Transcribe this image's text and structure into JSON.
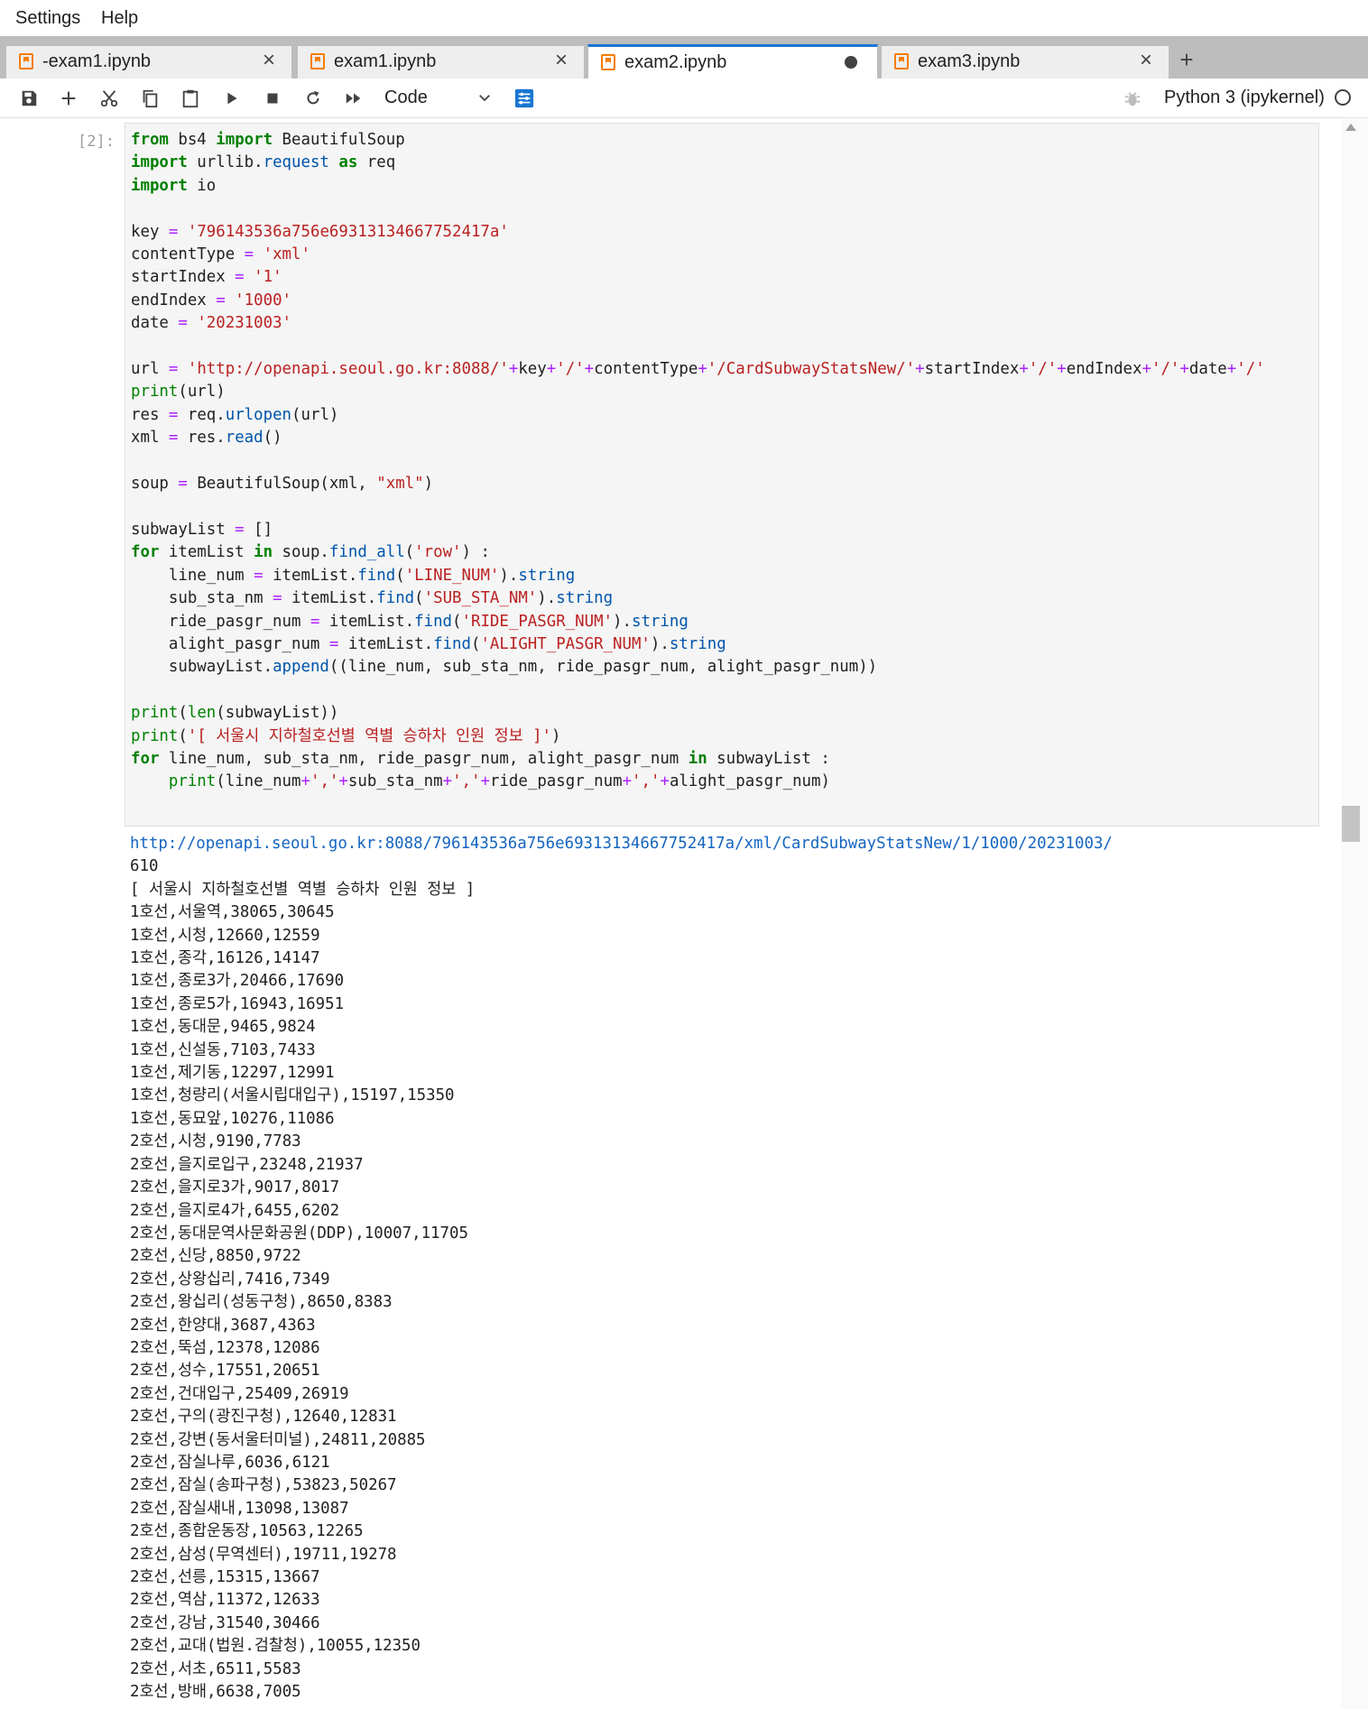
{
  "menu": {
    "settings": "Settings",
    "help": "Help"
  },
  "tabs": [
    {
      "label": "-exam1.ipynb",
      "state": "close"
    },
    {
      "label": "exam1.ipynb",
      "state": "close"
    },
    {
      "label": "exam2.ipynb",
      "state": "unsaved",
      "active": true
    },
    {
      "label": "exam3.ipynb",
      "state": "close"
    }
  ],
  "toolbar": {
    "icons": [
      "save-icon",
      "add-cell-icon",
      "cut-icon",
      "copy-icon",
      "paste-icon",
      "run-icon",
      "stop-icon",
      "restart-icon",
      "run-all-icon"
    ],
    "cell_type": "Code",
    "kernel": "Python 3 (ipykernel)"
  },
  "cell": {
    "prompt": "[2]:",
    "code_lines": [
      "from bs4 import BeautifulSoup",
      "import urllib.request as req",
      "import io",
      "",
      "key = '796143536a756e69313134667752417a'",
      "contentType = 'xml'",
      "startIndex = '1'",
      "endIndex = '1000'",
      "date = '20231003'",
      "",
      "url = 'http://openapi.seoul.go.kr:8088/'+key+'/'+contentType+'/CardSubwayStatsNew/'+startIndex+'/'+endIndex+'/'+date+'/'",
      "print(url)",
      "res = req.urlopen(url)",
      "xml = res.read()",
      "",
      "soup = BeautifulSoup(xml, \"xml\")",
      "",
      "subwayList = []",
      "for itemList in soup.find_all('row') :",
      "    line_num = itemList.find('LINE_NUM').string",
      "    sub_sta_nm = itemList.find('SUB_STA_NM').string",
      "    ride_pasgr_num = itemList.find('RIDE_PASGR_NUM').string",
      "    alight_pasgr_num = itemList.find('ALIGHT_PASGR_NUM').string",
      "    subwayList.append((line_num, sub_sta_nm, ride_pasgr_num, alight_pasgr_num))",
      "",
      "print(len(subwayList))",
      "print('[ 서울시 지하철호선별 역별 승하차 인원 정보 ]')",
      "for line_num, sub_sta_nm, ride_pasgr_num, alight_pasgr_num in subwayList :",
      "    print(line_num+','+sub_sta_nm+','+ride_pasgr_num+','+alight_pasgr_num)"
    ],
    "output_url": "http://openapi.seoul.go.kr:8088/796143536a756e69313134667752417a/xml/CardSubwayStatsNew/1/1000/20231003/",
    "output_lines": [
      "610",
      "[ 서울시 지하철호선별 역별 승하차 인원 정보 ]",
      "1호선,서울역,38065,30645",
      "1호선,시청,12660,12559",
      "1호선,종각,16126,14147",
      "1호선,종로3가,20466,17690",
      "1호선,종로5가,16943,16951",
      "1호선,동대문,9465,9824",
      "1호선,신설동,7103,7433",
      "1호선,제기동,12297,12991",
      "1호선,청량리(서울시립대입구),15197,15350",
      "1호선,동묘앞,10276,11086",
      "2호선,시청,9190,7783",
      "2호선,을지로입구,23248,21937",
      "2호선,을지로3가,9017,8017",
      "2호선,을지로4가,6455,6202",
      "2호선,동대문역사문화공원(DDP),10007,11705",
      "2호선,신당,8850,9722",
      "2호선,상왕십리,7416,7349",
      "2호선,왕십리(성동구청),8650,8383",
      "2호선,한양대,3687,4363",
      "2호선,뚝섬,12378,12086",
      "2호선,성수,17551,20651",
      "2호선,건대입구,25409,26919",
      "2호선,구의(광진구청),12640,12831",
      "2호선,강변(동서울터미널),24811,20885",
      "2호선,잠실나루,6036,6121",
      "2호선,잠실(송파구청),53823,50267",
      "2호선,잠실새내,13098,13087",
      "2호선,종합운동장,10563,12265",
      "2호선,삼성(무역센터),19711,19278",
      "2호선,선릉,15315,13667",
      "2호선,역삼,11372,12633",
      "2호선,강남,31540,30466",
      "2호선,교대(법원.검찰청),10055,12350",
      "2호선,서초,6511,5583",
      "2호선,방배,6638,7005"
    ]
  },
  "colors": {
    "accent": "#1976d2",
    "tab_icon": "#f57c00",
    "keyword": "#008000",
    "string": "#ba2121",
    "operator": "#aa22ff",
    "link": "#1565c0"
  }
}
